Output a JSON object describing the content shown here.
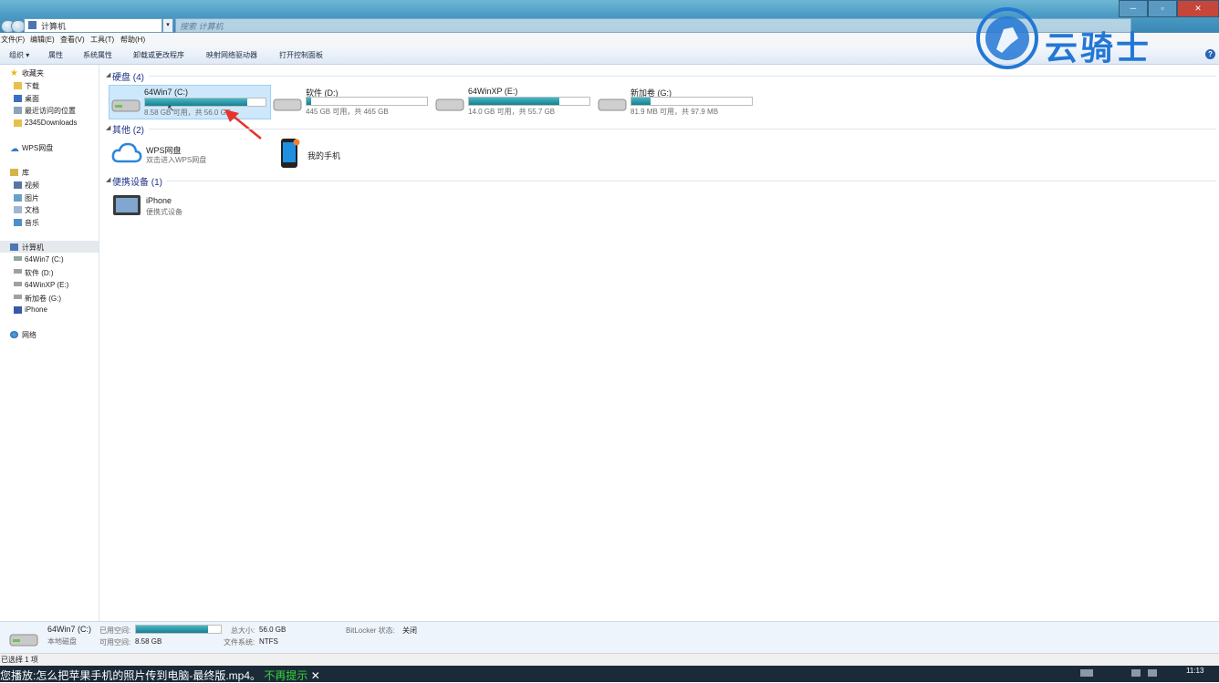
{
  "window": {
    "address_text": "计算机",
    "search_placeholder": "搜索 计算机",
    "min_label": "─",
    "max_label": "▫",
    "close_label": "✕"
  },
  "menu": [
    "文件(F)",
    "编辑(E)",
    "查看(V)",
    "工具(T)",
    "帮助(H)"
  ],
  "toolbar": {
    "organize": "组织 ▾",
    "properties": "属性",
    "system_properties": "系统属性",
    "uninstall": "卸载或更改程序",
    "map_drive": "映射网络驱动器",
    "control_panel": "打开控制面板",
    "help": "?"
  },
  "sidebar": {
    "favorites": "收藏夹",
    "downloads": "下载",
    "desktop": "桌面",
    "recent": "最近访问的位置",
    "downloads2345": "2345Downloads",
    "wps": "WPS网盘",
    "libraries": "库",
    "videos": "视频",
    "pictures": "图片",
    "documents": "文档",
    "music": "音乐",
    "computer": "计算机",
    "drive_c": "64Win7  (C:)",
    "drive_d": "软件 (D:)",
    "drive_e": "64WinXP  (E:)",
    "drive_g": "新加卷 (G:)",
    "iphone": "iPhone",
    "network": "网络"
  },
  "groups": {
    "hard_disks": "硬盘 (4)",
    "other": "其他 (2)",
    "portable": "便携设备 (1)"
  },
  "drives": [
    {
      "name": "64Win7  (C:)",
      "free": "8.58 GB 可用，共 56.0 GB",
      "used_fraction": 0.85,
      "selected": true
    },
    {
      "name": "软件 (D:)",
      "free": "445 GB 可用，共 465 GB",
      "used_fraction": 0.04,
      "selected": false
    },
    {
      "name": "64WinXP  (E:)",
      "free": "14.0 GB 可用，共 55.7 GB",
      "used_fraction": 0.75,
      "selected": false
    },
    {
      "name": "新加卷 (G:)",
      "free": "81.9 MB 可用，共 97.9 MB",
      "used_fraction": 0.16,
      "selected": false
    }
  ],
  "other_items": {
    "wps_title": "WPS网盘",
    "wps_sub": "双击进入WPS网盘",
    "phone_title": "我的手机"
  },
  "portable_items": {
    "iphone_title": "iPhone",
    "iphone_sub": "便携式设备"
  },
  "details": {
    "name": "64Win7  (C:)",
    "type": "本地磁盘",
    "used_label": "已用空间:",
    "used_fraction": 0.85,
    "free_label": "可用空间:",
    "free_value": "8.58 GB",
    "total_label": "总大小:",
    "total_value": "56.0 GB",
    "fs_label": "文件系统:",
    "fs_value": "NTFS",
    "bitlocker_label": "BitLocker 状态:",
    "bitlocker_value": "关闭"
  },
  "status": "已选择 1 项",
  "subtitle": {
    "text": "您播放:怎么把苹果手机的照片传到电脑-最终版.mp4。",
    "link": "不再提示",
    "close": "✕"
  },
  "taskbar": {
    "time": "11:13"
  },
  "watermark": "云骑士",
  "colors": {
    "accent": "#1e3287",
    "watermark": "#2377d5",
    "bar_fill": "#14808f"
  }
}
